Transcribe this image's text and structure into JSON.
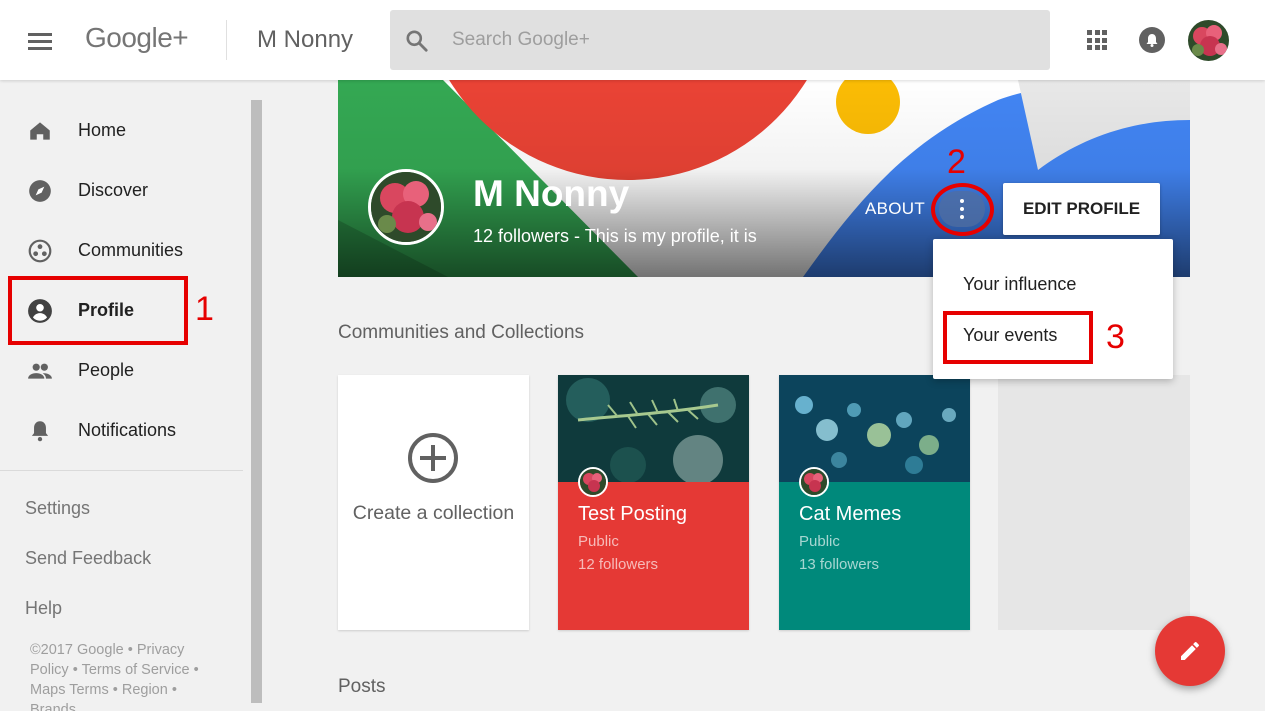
{
  "header": {
    "logo": "Google+",
    "page_title": "M Nonny",
    "search_placeholder": "Search Google+"
  },
  "sidebar": {
    "items": [
      {
        "label": "Home",
        "icon": "home-icon"
      },
      {
        "label": "Discover",
        "icon": "compass-icon"
      },
      {
        "label": "Communities",
        "icon": "communities-icon"
      },
      {
        "label": "Profile",
        "icon": "profile-icon"
      },
      {
        "label": "People",
        "icon": "people-icon"
      },
      {
        "label": "Notifications",
        "icon": "bell-icon"
      }
    ],
    "links": [
      "Settings",
      "Send Feedback",
      "Help"
    ],
    "footer": {
      "copyright": "©2017 Google",
      "privacy": "Privacy Policy",
      "terms": "Terms of Service",
      "maps": "Maps Terms",
      "region": "Region",
      "brands": "Brands"
    }
  },
  "profile": {
    "name": "M Nonny",
    "tagline": "12 followers - This is my profile, it is",
    "about_label": "ABOUT",
    "edit_label": "EDIT PROFILE"
  },
  "menu": {
    "items": [
      "Your influence",
      "Your events"
    ]
  },
  "annotations": {
    "n1": "1",
    "n2": "2",
    "n3": "3",
    "color": "#e60000"
  },
  "collections": {
    "section_title": "Communities and Collections",
    "create_label": "Create a collection",
    "cards": [
      {
        "title": "Test Posting",
        "visibility": "Public",
        "followers": "12 followers",
        "color": "#e53935"
      },
      {
        "title": "Cat Memes",
        "visibility": "Public",
        "followers": "13 followers",
        "color": "#00897b"
      }
    ]
  },
  "posts": {
    "section_title": "Posts"
  }
}
